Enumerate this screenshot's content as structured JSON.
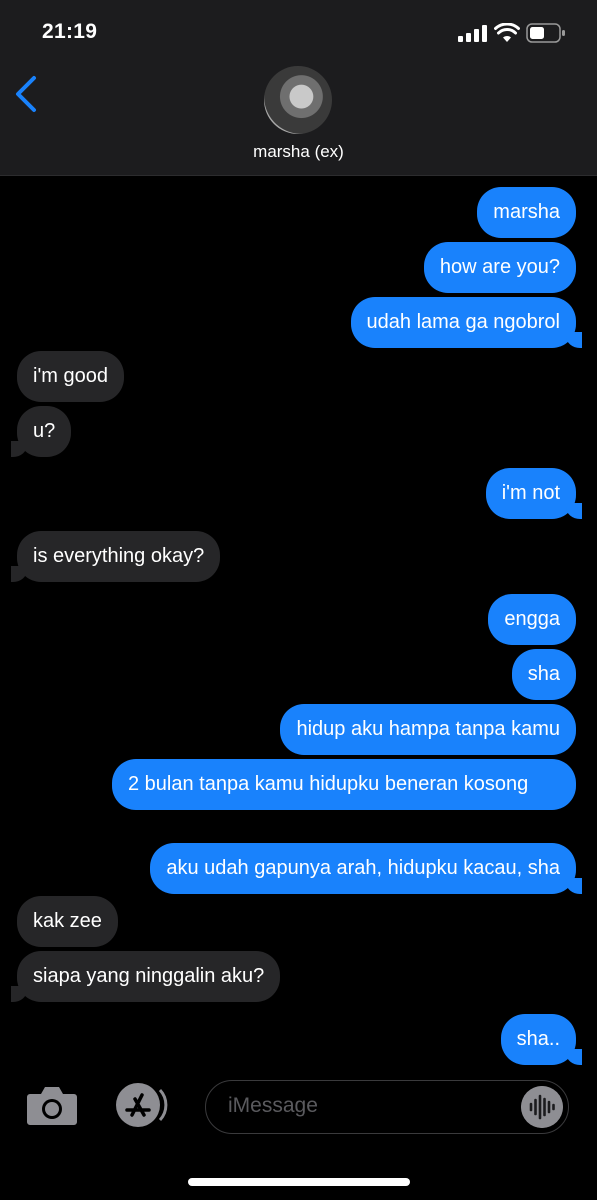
{
  "status_bar": {
    "time": "21:19"
  },
  "contact": {
    "name": "marsha (ex)"
  },
  "messages": [
    {
      "dir": "out",
      "text": "marsha"
    },
    {
      "dir": "out",
      "text": "how are you?"
    },
    {
      "dir": "out",
      "text": "udah lama ga ngobrol"
    },
    {
      "dir": "in",
      "text": "i'm good"
    },
    {
      "dir": "in",
      "text": "u?"
    },
    {
      "dir": "out",
      "text": "i'm not"
    },
    {
      "dir": "in",
      "text": "is everything okay?"
    },
    {
      "dir": "out",
      "text": "engga"
    },
    {
      "dir": "out",
      "text": "sha"
    },
    {
      "dir": "out",
      "text": "hidup aku hampa tanpa kamu"
    },
    {
      "dir": "out",
      "text": "2 bulan tanpa kamu hidupku beneran kosong"
    },
    {
      "dir": "out",
      "text": "aku udah gapunya arah, hidupku kacau, sha"
    },
    {
      "dir": "in",
      "text": "kak zee"
    },
    {
      "dir": "in",
      "text": "siapa yang ninggalin aku?"
    },
    {
      "dir": "out",
      "text": "sha.."
    }
  ],
  "composer": {
    "placeholder": "iMessage"
  },
  "colors": {
    "outgoing": "#1982fc",
    "incoming": "#262628",
    "background": "#000000"
  },
  "icons": [
    "back-chevron-icon",
    "camera-icon",
    "app-store-icon",
    "voice-waveform-icon"
  ]
}
